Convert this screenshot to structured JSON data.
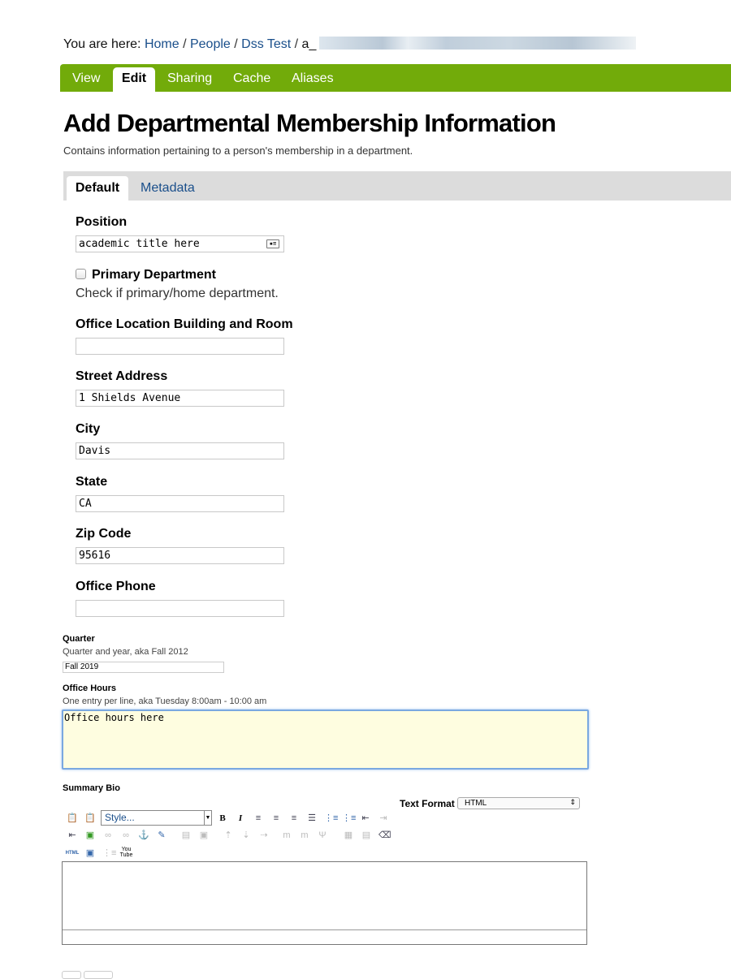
{
  "breadcrumb": {
    "prefix": "You are here:",
    "items": [
      "Home",
      "People",
      "Dss Test"
    ],
    "current": "a_"
  },
  "tabs": [
    "View",
    "Edit",
    "Sharing",
    "Cache",
    "Aliases"
  ],
  "page": {
    "title": "Add Departmental Membership Information",
    "description": "Contains information pertaining to a person's membership in a department."
  },
  "form_tabs": [
    "Default",
    "Metadata"
  ],
  "fields": {
    "position": {
      "label": "Position",
      "value": "academic title here"
    },
    "primary": {
      "label": "Primary Department",
      "help": "Check if primary/home department.",
      "checked": false
    },
    "office_location": {
      "label": "Office Location Building and Room",
      "value": ""
    },
    "street": {
      "label": "Street Address",
      "value": "1 Shields Avenue"
    },
    "city": {
      "label": "City",
      "value": "Davis"
    },
    "state": {
      "label": "State",
      "value": "CA"
    },
    "zip": {
      "label": "Zip Code",
      "value": "95616"
    },
    "phone": {
      "label": "Office Phone",
      "value": ""
    },
    "quarter": {
      "label": "Quarter",
      "help": "Quarter and year, aka Fall 2012",
      "value": "Fall 2019"
    },
    "office_hours": {
      "label": "Office Hours",
      "help": "One entry per line, aka Tuesday 8:00am - 10:00 am",
      "value": "Office hours here"
    },
    "bio": {
      "label": "Summary Bio",
      "text_format_label": "Text Format",
      "text_format": "HTML",
      "style_placeholder": "Style...",
      "html_icon": "HTML",
      "youtube_icon": "You Tube"
    }
  },
  "colors": {
    "tab_bar": "#72ab0a",
    "link": "#1a4f8b",
    "focus_bg": "#fefde0"
  }
}
